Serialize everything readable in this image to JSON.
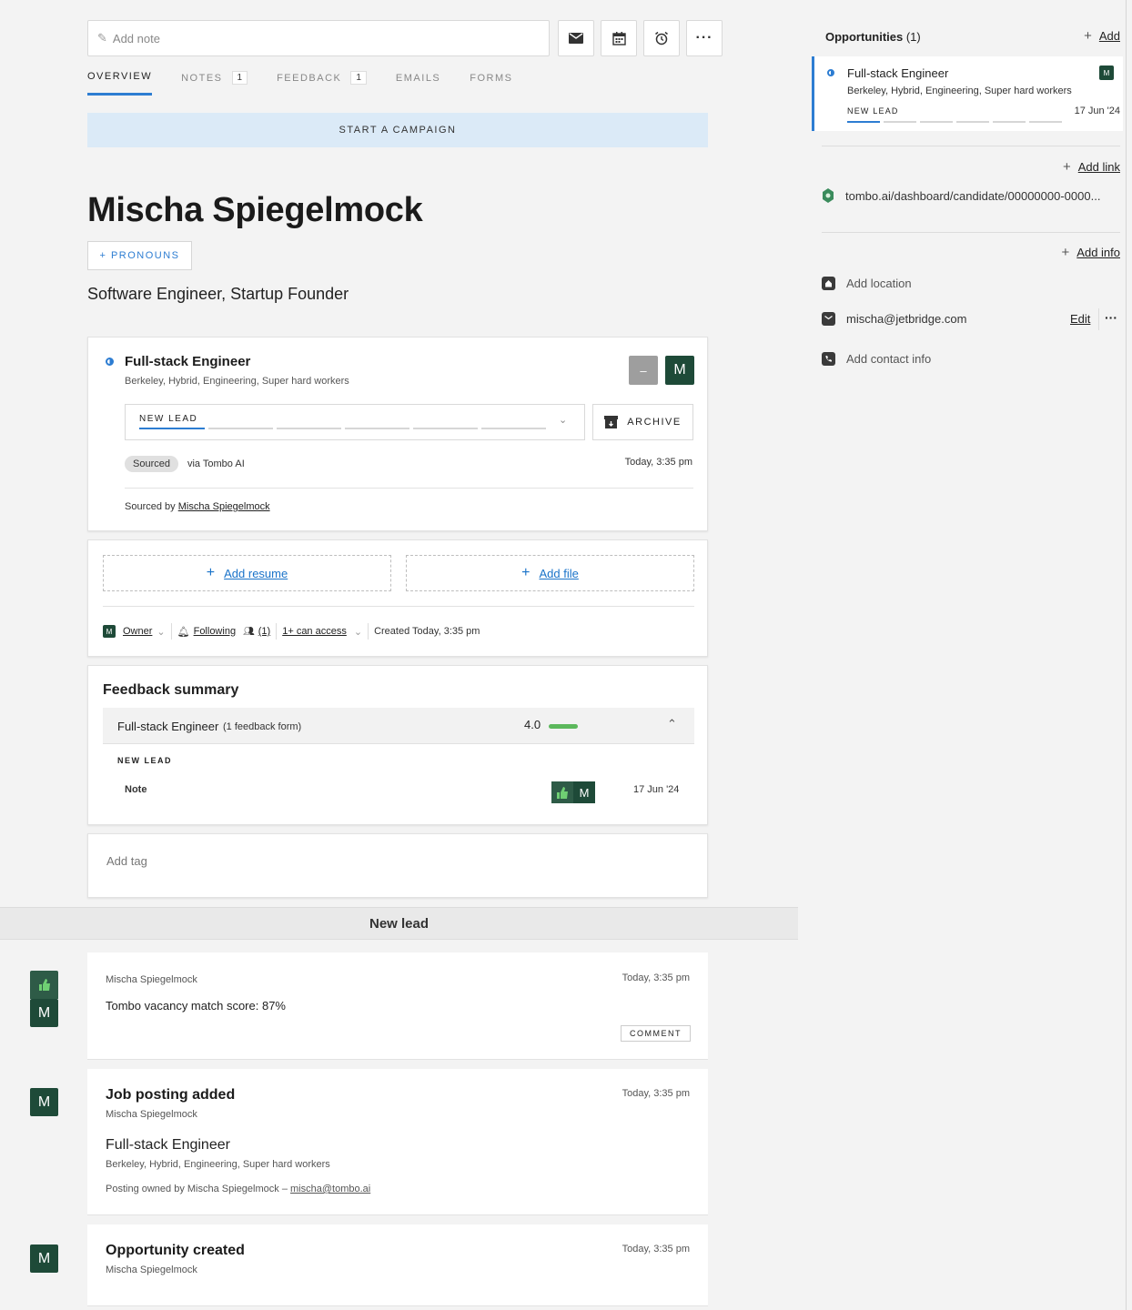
{
  "toolbar": {
    "note_placeholder": "Add note",
    "icons": [
      "email-icon",
      "calendar-icon",
      "alarm-icon",
      "more-icon"
    ]
  },
  "tabs": [
    {
      "label": "OVERVIEW",
      "count": ""
    },
    {
      "label": "NOTES",
      "count": "1"
    },
    {
      "label": "FEEDBACK",
      "count": "1"
    },
    {
      "label": "EMAILS",
      "count": ""
    },
    {
      "label": "FORMS",
      "count": ""
    }
  ],
  "campaign_label": "START A CAMPAIGN",
  "candidate": {
    "name": "Mischa Spiegelmock",
    "pronouns_label": "+ PRONOUNS",
    "headline": "Software Engineer, Startup Founder"
  },
  "opportunity": {
    "title": "Full-stack Engineer",
    "subtitle": "Berkeley, Hybrid, Engineering, Super hard workers",
    "gray_avatar": "–",
    "owner_initial": "M",
    "stage": "NEW LEAD",
    "archive_label": "ARCHIVE",
    "source_badge": "Sourced",
    "source_via": "via Tombo AI",
    "source_time": "Today, 3:35 pm",
    "sourced_by_prefix": "Sourced by",
    "sourced_by_name": "Mischa Spiegelmock"
  },
  "files": {
    "add_resume": "Add resume",
    "add_file": "Add file",
    "owner_initial": "M",
    "owner_label": "Owner",
    "following_label": "Following",
    "followers_count": "(1)",
    "access_label": "1+ can access",
    "created_label": "Created Today, 3:35 pm"
  },
  "feedback": {
    "title": "Feedback summary",
    "job": "Full-stack Engineer",
    "forms": "(1 feedback form)",
    "score": "4.0",
    "score_fraction": 0.8,
    "stage": "NEW LEAD",
    "item": "Note",
    "initial": "M",
    "date": "17 Jun '24"
  },
  "tag_placeholder": "Add tag",
  "section_header": "New lead",
  "timeline": [
    {
      "author": "Mischa Spiegelmock",
      "time": "Today, 3:35 pm",
      "text": "Tombo vacancy match score: 87%",
      "action": "COMMENT",
      "initial": "M"
    },
    {
      "heading": "Job posting added",
      "author": "Mischa Spiegelmock",
      "time": "Today, 3:35 pm",
      "job": "Full-stack Engineer",
      "job_sub": "Berkeley, Hybrid, Engineering, Super hard workers",
      "owned_prefix": "Posting owned by Mischa Spiegelmock –",
      "owned_email": "mischa@tombo.ai",
      "initial": "M"
    },
    {
      "heading": "Opportunity created",
      "author": "Mischa Spiegelmock",
      "time": "Today, 3:35 pm",
      "initial": "M"
    }
  ],
  "right_panel": {
    "opportunities_title": "Opportunities",
    "opportunities_count": "(1)",
    "add_label": "Add",
    "opp_title": "Full-stack Engineer",
    "opp_sub": "Berkeley, Hybrid, Engineering, Super hard workers",
    "opp_stage": "NEW LEAD",
    "opp_date": "17 Jun '24",
    "opp_initial": "M",
    "add_link_label": "Add link",
    "link_url": "tombo.ai/dashboard/candidate/00000000-0000...",
    "add_info_label": "Add info",
    "add_location": "Add location",
    "email": "mischa@jetbridge.com",
    "edit_label": "Edit",
    "add_contact": "Add contact info"
  },
  "colors": {
    "accent": "#2d7dd2",
    "avatar_green": "#1e4a38",
    "score_green": "#5cb85c",
    "campaign_bg": "#dbeaf7"
  }
}
